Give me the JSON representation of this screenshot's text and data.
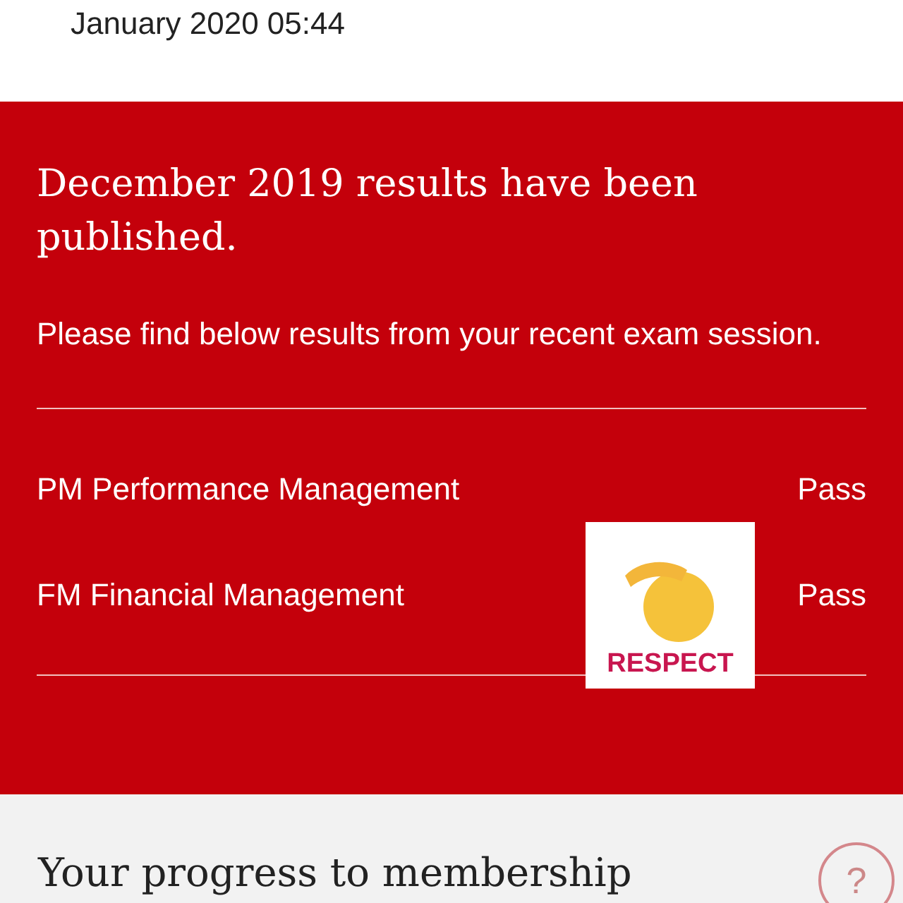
{
  "header": {
    "date": "January 2020 05:44"
  },
  "notice": {
    "title": "December 2019 results have been published.",
    "message": "Please find below results from your recent exam session.",
    "results": [
      {
        "subject": "PM Performance Management",
        "result": "Pass"
      },
      {
        "subject": "FM Financial Management",
        "result": "Pass"
      }
    ],
    "sticker": {
      "caption": "RESPECT"
    }
  },
  "progress": {
    "title": "Your progress to membership",
    "help": "?"
  }
}
